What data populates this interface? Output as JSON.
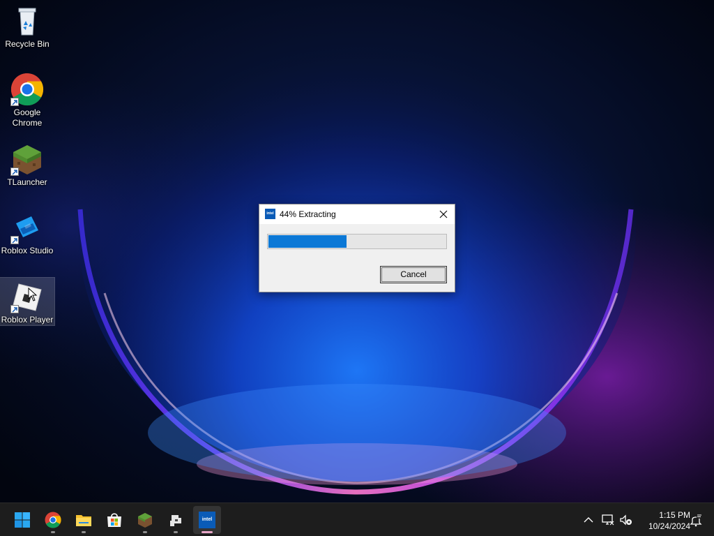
{
  "desktop": {
    "icons": [
      {
        "label": "Recycle Bin",
        "icon": "recycle-bin-icon"
      },
      {
        "label": "Google",
        "label2": "Chrome",
        "icon": "chrome-icon",
        "shortcut": true
      },
      {
        "label": "TLauncher",
        "icon": "tlauncher-icon",
        "shortcut": true
      },
      {
        "label": "Roblox Studio",
        "icon": "roblox-studio-icon",
        "shortcut": true
      },
      {
        "label": "Roblox Player",
        "icon": "roblox-player-icon",
        "shortcut": true,
        "selected": true
      }
    ]
  },
  "dialog": {
    "title": "44% Extracting",
    "app_icon_text": "intel",
    "progress": 0.44,
    "progress_color": "#0b78d6",
    "cancel_label": "Cancel"
  },
  "taskbar": {
    "apps": [
      "start-icon",
      "chrome-icon",
      "file-explorer-icon",
      "microsoft-store-icon",
      "tlauncher-icon",
      "roblox-player-icon",
      "intel-installer-icon"
    ],
    "active_app": "intel-installer-icon",
    "intel_label": "intel",
    "tray": [
      "chevron-up-icon",
      "network-icon",
      "volume-muted-icon",
      "notification-icon"
    ],
    "time": "1:15 PM",
    "date": "10/24/2024"
  },
  "colors": {
    "accent": "#0b78d6",
    "taskbar": "#1d1d1d",
    "active_indicator": "#e8a7c8"
  }
}
